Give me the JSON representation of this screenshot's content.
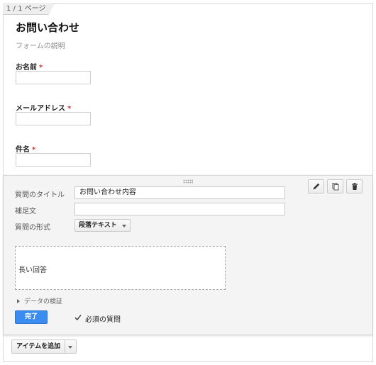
{
  "page_indicator": "1 / 1 ページ",
  "form": {
    "title": "お問い合わせ",
    "description": "フォームの説明"
  },
  "questions": [
    {
      "label": "お名前",
      "required_mark": "*"
    },
    {
      "label": "メールアドレス",
      "required_mark": "*"
    },
    {
      "label": "件名",
      "required_mark": "*"
    }
  ],
  "editor": {
    "title_label": "質問のタイトル",
    "title_value": "お問い合わせ内容",
    "help_label": "補足文",
    "help_value": "",
    "type_label": "質問の形式",
    "type_value": "段落テキスト",
    "preview_text": "長い回答",
    "validation_label": "データの検証",
    "done_label": "完了",
    "required_label": "必須の質問",
    "required_checked": true,
    "tools": [
      "pencil-icon",
      "copy-icon",
      "trash-icon"
    ]
  },
  "add_item": {
    "label": "アイテムを追加"
  },
  "colors": {
    "accent": "#3b8cf0",
    "required": "#d93025",
    "panel_bg": "#f4f4f4"
  }
}
